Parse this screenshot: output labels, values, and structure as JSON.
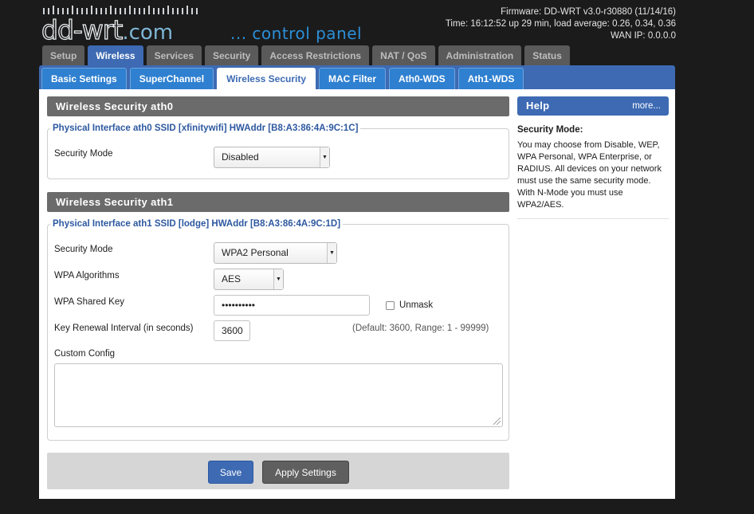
{
  "brand": {
    "logo_text": "dd-wrt",
    "logo_suffix": ".com",
    "tagline": "... control panel"
  },
  "system": {
    "firmware": "Firmware: DD-WRT v3.0-r30880 (11/14/16)",
    "time": "Time: 16:12:52 up 29 min, load average: 0.26, 0.34, 0.36",
    "wan_ip": "WAN IP: 0.0.0.0"
  },
  "main_tabs": [
    {
      "label": "Setup",
      "active": false
    },
    {
      "label": "Wireless",
      "active": true
    },
    {
      "label": "Services",
      "active": false
    },
    {
      "label": "Security",
      "active": false
    },
    {
      "label": "Access Restrictions",
      "active": false
    },
    {
      "label": "NAT / QoS",
      "active": false
    },
    {
      "label": "Administration",
      "active": false
    },
    {
      "label": "Status",
      "active": false
    }
  ],
  "sub_tabs": [
    {
      "label": "Basic Settings",
      "active": false
    },
    {
      "label": "SuperChannel",
      "active": false
    },
    {
      "label": "Wireless Security",
      "active": true
    },
    {
      "label": "MAC Filter",
      "active": false
    },
    {
      "label": "Ath0-WDS",
      "active": false
    },
    {
      "label": "Ath1-WDS",
      "active": false
    }
  ],
  "ath0": {
    "section_title": "Wireless Security ath0",
    "legend": "Physical Interface ath0 SSID [xfinitywifi] HWAddr [B8:A3:86:4A:9C:1C]",
    "security_mode_label": "Security Mode",
    "security_mode_value": "Disabled"
  },
  "ath1": {
    "section_title": "Wireless Security ath1",
    "legend": "Physical Interface ath1 SSID [lodge] HWAddr [B8:A3:86:4A:9C:1D]",
    "security_mode_label": "Security Mode",
    "security_mode_value": "WPA2 Personal",
    "wpa_algorithms_label": "WPA Algorithms",
    "wpa_algorithms_value": "AES",
    "shared_key_label": "WPA Shared Key",
    "shared_key_value": "••••••••••",
    "unmask_label": "Unmask",
    "unmask_checked": false,
    "renewal_label": "Key Renewal Interval (in seconds)",
    "renewal_value": "3600",
    "renewal_hint": "(Default: 3600, Range: 1 - 99999)",
    "custom_config_label": "Custom Config",
    "custom_config_value": ""
  },
  "buttons": {
    "save": "Save",
    "apply": "Apply Settings"
  },
  "help": {
    "title": "Help",
    "more": "more...",
    "subtitle": "Security Mode:",
    "text": "You may choose from Disable, WEP, WPA Personal, WPA Enterprise, or RADIUS. All devices on your network must use the same security mode. With N-Mode you must use WPA2/AES."
  },
  "colors": {
    "accent": "#3d6ab3",
    "sub_tab": "#2f80d0",
    "section_bar": "#6b6b6b",
    "page_bg": "#1b1b1b"
  }
}
